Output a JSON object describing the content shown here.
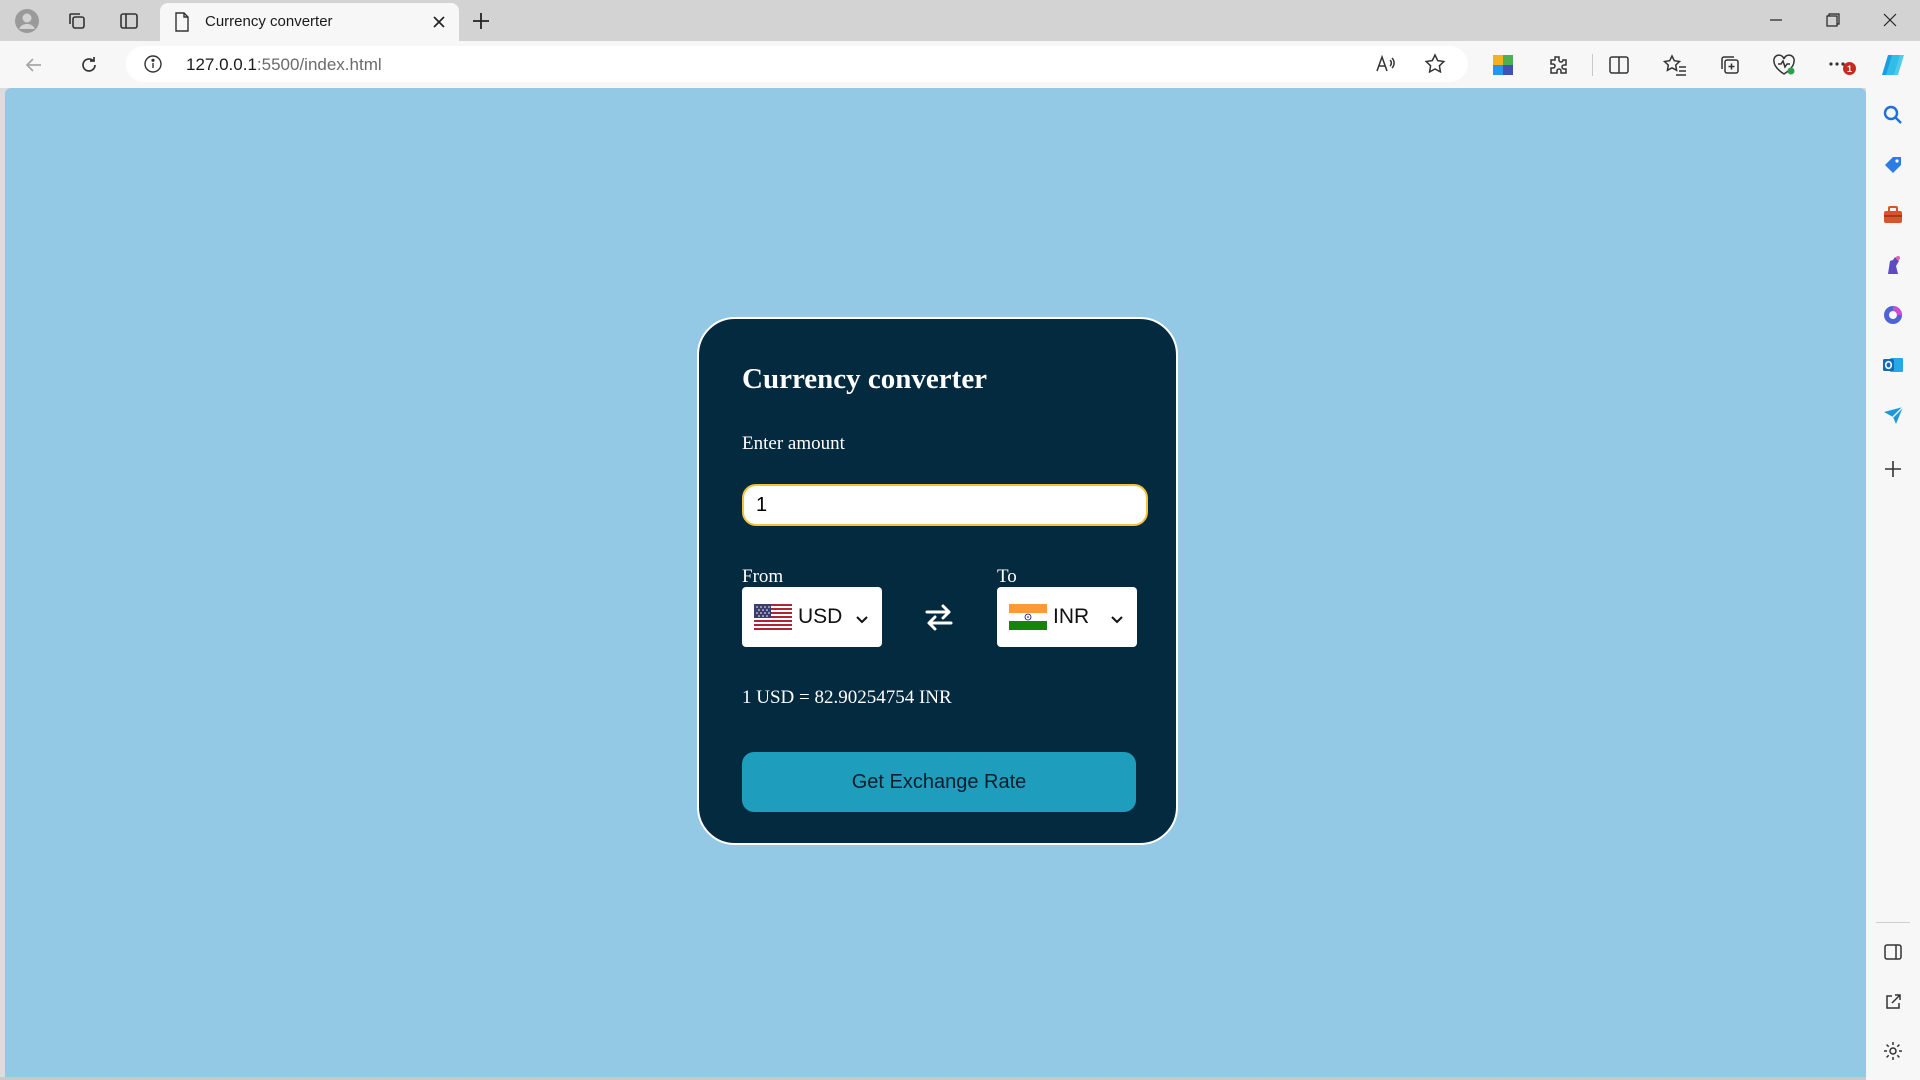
{
  "browser": {
    "tab": {
      "title": "Currency converter"
    },
    "address": {
      "host": "127.0.0.1",
      "path": ":5500/index.html"
    },
    "icons": {
      "titlebar": [
        "profile-icon",
        "workspaces-icon",
        "vertical-tabs-icon",
        "page-icon",
        "close-icon",
        "plus-icon",
        "minimize-icon",
        "restore-icon",
        "close-window-icon"
      ],
      "toolbar": [
        "back-icon",
        "refresh-icon",
        "info-icon",
        "read-aloud-icon",
        "favorite-star-icon",
        "extension-app-icon",
        "extensions-icon",
        "split-screen-icon",
        "favorites-icon",
        "collections-icon",
        "browser-essentials-icon",
        "more-icon",
        "copilot-icon"
      ],
      "sidebar": [
        "search-icon",
        "shopping-icon",
        "tools-icon",
        "games-icon",
        "microsoft365-icon",
        "outlook-icon",
        "send-icon",
        "add-icon",
        "hide-sidebar-icon",
        "external-link-icon",
        "settings-icon"
      ]
    },
    "notification_badge": "1"
  },
  "app": {
    "title": "Currency converter",
    "amount_label": "Enter amount",
    "amount_value": "1",
    "from_label": "From",
    "to_label": "To",
    "from_currency": "USD",
    "to_currency": "INR",
    "rate_text": "1 USD = 82.90254754 INR",
    "button_label": "Get Exchange Rate"
  },
  "colors": {
    "page_background": "#93c9e4",
    "card_background": "#042a40",
    "button_background": "#1f9dbd",
    "input_border": "#f3c33a"
  }
}
